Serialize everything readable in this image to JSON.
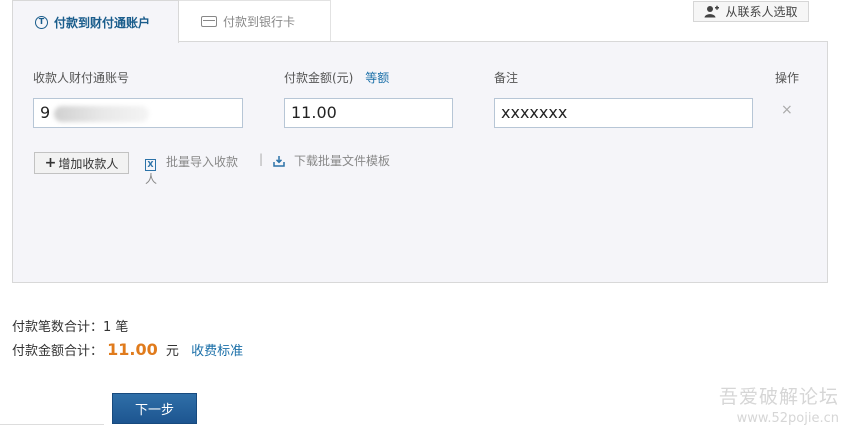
{
  "tabs": [
    {
      "label": "付款到财付通账户",
      "icon": "tenpay-icon",
      "active": true
    },
    {
      "label": "付款到银行卡",
      "icon": "bank-card-icon",
      "active": false
    }
  ],
  "contacts_button": "从联系人选取",
  "columns": {
    "account": "收款人财付通账号",
    "amount": "付款金额(元)",
    "equal_amount": "等额",
    "note": "备注",
    "action": "操作"
  },
  "row": {
    "account_prefix": "9",
    "amount": "11.00",
    "note": "xxxxxxx",
    "remove": "×"
  },
  "actions": {
    "add_payee": "增加收款人",
    "batch_import": "批量导入收款人",
    "separator": "|",
    "download_template": "下载批量文件模板"
  },
  "summary": {
    "count_label": "付款笔数合计：",
    "count_value": "1 笔",
    "total_label": "付款金额合计：",
    "total_value": "11.00",
    "total_unit": "元",
    "fee_link": "收费标准"
  },
  "next_button": "下一步",
  "watermark": {
    "title": "吾爱破解论坛",
    "url": "www.52pojie.cn"
  },
  "colors": {
    "accent": "#1a5d8c",
    "amount": "#e07b1c",
    "button": "#1d5590"
  }
}
